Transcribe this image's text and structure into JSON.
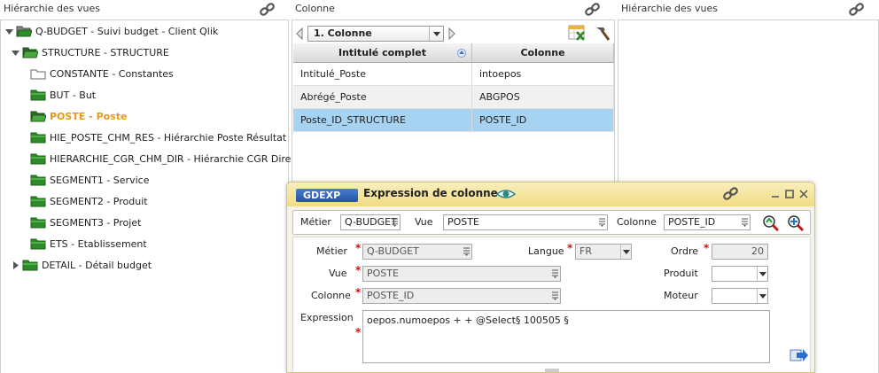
{
  "left_panel": {
    "title": "Hiérarchie des vues",
    "tree": [
      {
        "label": "Q-BUDGET - Suivi budget - Client Qlik",
        "level": 0,
        "expanded": true,
        "folder": "open-dark"
      },
      {
        "label": "STRUCTURE - STRUCTURE",
        "level": 1,
        "expanded": true,
        "folder": "open-green"
      },
      {
        "label": "CONSTANTE - Constantes",
        "level": 2,
        "folder": "empty"
      },
      {
        "label": "BUT - But",
        "level": 2,
        "folder": "green"
      },
      {
        "label": "POSTE - Poste",
        "level": 2,
        "folder": "open-green",
        "active": true
      },
      {
        "label": "HIE_POSTE_CHM_RES - Hiérarchie Poste Résultat",
        "level": 2,
        "folder": "green"
      },
      {
        "label": "HIERARCHIE_CGR_CHM_DIR - Hiérarchie CGR Direction",
        "level": 2,
        "folder": "green"
      },
      {
        "label": "SEGMENT1 - Service",
        "level": 2,
        "folder": "green"
      },
      {
        "label": "SEGMENT2 - Produit",
        "level": 2,
        "folder": "green"
      },
      {
        "label": "SEGMENT3 - Projet",
        "level": 2,
        "folder": "green"
      },
      {
        "label": "ETS - Etablissement",
        "level": 2,
        "folder": "green"
      },
      {
        "label": "DETAIL - Détail budget",
        "level": 1,
        "expanded": false,
        "folder": "green"
      }
    ]
  },
  "middle_panel": {
    "title": "Colonne",
    "selector": "1. Colonne",
    "columns": [
      "Intitulé complet",
      "Colonne"
    ],
    "rows": [
      [
        "Intitulé_Poste",
        "intoepos"
      ],
      [
        "Abrégé_Poste",
        "ABGPOS"
      ],
      [
        "Poste_ID_STRUCTURE",
        "POSTE_ID"
      ]
    ],
    "selected_row": 2
  },
  "right_panel": {
    "title": "Hiérarchie des vues"
  },
  "dialog": {
    "code": "GDEXP",
    "title": "Expression de colonne",
    "filter": {
      "metier_label": "Métier",
      "metier_value": "Q-BUDGET",
      "vue_label": "Vue",
      "vue_value": "POSTE",
      "colonne_label": "Colonne",
      "colonne_value": "POSTE_ID"
    },
    "form": {
      "metier_label": "Métier",
      "metier_value": "Q-BUDGET",
      "langue_label": "Langue",
      "langue_value": "FR",
      "ordre_label": "Ordre",
      "ordre_value": "20",
      "vue_label": "Vue",
      "vue_value": "POSTE",
      "produit_label": "Produit",
      "produit_value": "",
      "colonne_label": "Colonne",
      "colonne_value": "POSTE_ID",
      "moteur_label": "Moteur",
      "moteur_value": "",
      "expression_label": "Expression",
      "expression_value": "oepos.numoepos + + @Select§ 100505 §",
      "required_mark": "*"
    }
  },
  "colors": {
    "active_tree": "#e39a1f",
    "selected_row": "#a7d3f2",
    "dialog_title": "#f1dc83",
    "required": "#d01010",
    "folder_green": "#2f8a2a"
  }
}
